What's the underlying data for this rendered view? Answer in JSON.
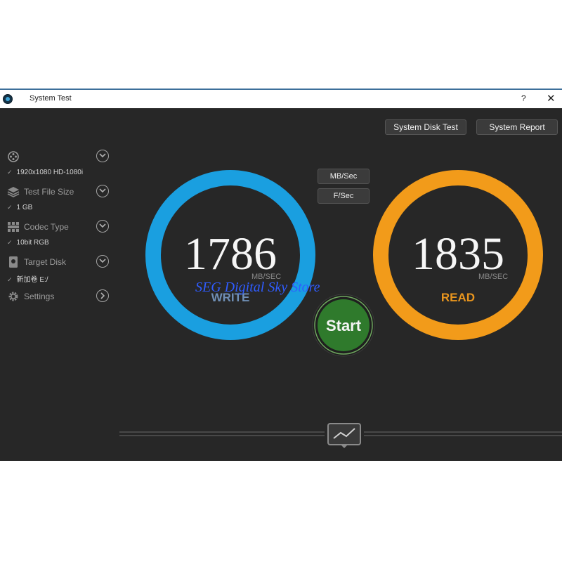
{
  "window": {
    "title": "System Test",
    "help_glyph": "?",
    "close_glyph": "✕"
  },
  "toolbar": {
    "disk_test_label": "System Disk Test",
    "report_label": "System Report"
  },
  "sidebar": {
    "items": [
      {
        "icon": "film-reel-icon",
        "label": "",
        "value": "1920x1080 HD-1080i"
      },
      {
        "icon": "stack-layers-icon",
        "label": "Test File Size",
        "value": "1 GB"
      },
      {
        "icon": "grid-codec-icon",
        "label": "Codec Type",
        "value": "10bit RGB"
      },
      {
        "icon": "hard-disk-icon",
        "label": "Target Disk",
        "value": "新加卷 E:/"
      },
      {
        "icon": "gear-icon",
        "label": "Settings"
      }
    ],
    "check_glyph": "✓"
  },
  "units": {
    "mbsec_label": "MB/Sec",
    "fsec_label": "F/Sec"
  },
  "write": {
    "value": "1786",
    "unit": "MB/SEC",
    "label": "WRITE",
    "color": "#1a9fe0",
    "label_color": "#6f8fb5"
  },
  "read": {
    "value": "1835",
    "unit": "MB/SEC",
    "label": "READ",
    "color": "#f29b1a",
    "label_color": "#e8951e"
  },
  "start": {
    "label": "Start",
    "color": "#2f7a2c"
  },
  "watermark": "SEG Digital Sky Store",
  "graph_icon": "line-graph-icon"
}
